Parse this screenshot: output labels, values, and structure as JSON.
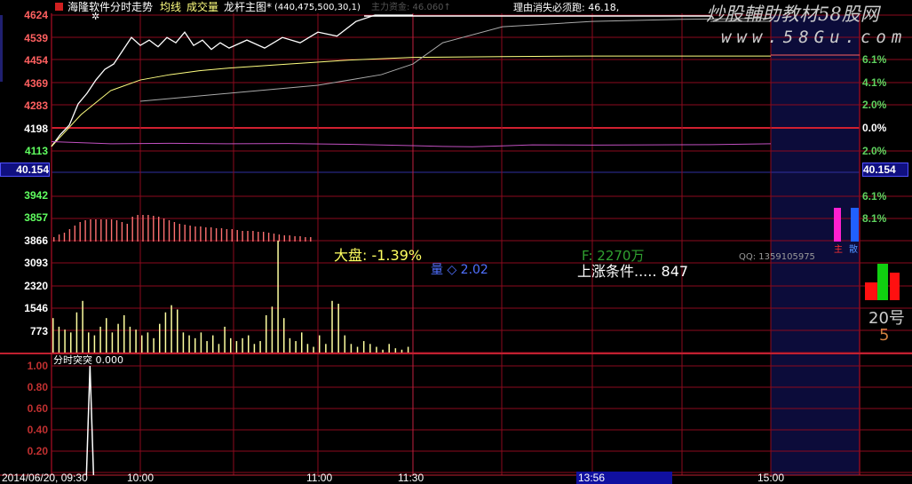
{
  "header": {
    "title": "海隆软件分时走势",
    "ma_label": "均线",
    "vol_label": "成交量",
    "main_label": "龙杆主图*",
    "params": "(440,475,500,30,1)",
    "main_force": "主力资金: 46.060↑",
    "reason": "理由消失必须跑: 46.18,"
  },
  "watermark": {
    "line1": "炒股輔助教材58股网",
    "line2": "www.58Gu.com"
  },
  "overlay": {
    "market": "大盘: -1.39%",
    "volume_ratio": "量 ◇ 2.02",
    "amount": "F: 2270万",
    "qq": "QQ: 1359105975",
    "rise_cond": "上涨条件..... 847"
  },
  "left_axis": {
    "price": [
      "4624",
      "4539",
      "4454",
      "4369",
      "4283",
      "4198",
      "4113"
    ],
    "highlight": "40.154",
    "lower": [
      "3942",
      "3857",
      "3866"
    ],
    "volume": [
      "3093",
      "2320",
      "1546",
      "773"
    ],
    "indicator": [
      "1.00",
      "0.80",
      "0.60",
      "0.40",
      "0.20"
    ]
  },
  "right_axis": {
    "pct": [
      "6.1%",
      "4.1%",
      "2.0%",
      "0.0%",
      "2.0%"
    ],
    "highlight": "40.154",
    "lower": [
      "6.1%",
      "8.1%"
    ],
    "labels": [
      "主",
      "散"
    ],
    "day": "20号",
    "num": "5"
  },
  "indicator": {
    "label": "分时突突 0.000"
  },
  "time_axis": {
    "date": "2014/06/20, 09:30",
    "ticks": [
      "10:00",
      "11:00",
      "11:30",
      "15:00"
    ],
    "cursor": "13:56"
  },
  "colors": {
    "grid": "#8b0a1e",
    "price": "#ffffff",
    "avg": "#ffff80",
    "trend": "#aaaaaa",
    "purple": "#c050c0",
    "volume": "#ffffa0",
    "upper_bars": "#ff7070",
    "shade": "#0c0c3a"
  },
  "chart_data": {
    "type": "line",
    "title": "海隆软件分时走势",
    "x_unit": "minutes since 09:30 (trading time)",
    "xlim": [
      0,
      240
    ],
    "ylim": [
      4113,
      4624
    ],
    "series": [
      {
        "name": "price",
        "x": [
          0,
          3,
          6,
          9,
          12,
          15,
          18,
          21,
          24,
          27,
          30,
          33,
          36,
          39,
          42,
          45,
          48,
          51,
          54,
          57,
          60,
          66,
          72,
          78,
          84,
          90,
          96,
          102,
          108,
          114,
          120
        ],
        "values": [
          4130,
          4175,
          4210,
          4290,
          4330,
          4380,
          4420,
          4440,
          4490,
          4540,
          4510,
          4530,
          4505,
          4540,
          4520,
          4560,
          4510,
          4530,
          4495,
          4520,
          4500,
          4530,
          4500,
          4540,
          4520,
          4560,
          4545,
          4600,
          4624,
          4624,
          4624
        ]
      },
      {
        "name": "avg",
        "x": [
          0,
          10,
          20,
          30,
          40,
          50,
          60,
          80,
          100,
          120,
          150,
          180,
          210,
          240
        ],
        "values": [
          4130,
          4250,
          4340,
          4380,
          4400,
          4415,
          4425,
          4440,
          4455,
          4465,
          4468,
          4470,
          4470,
          4470
        ]
      },
      {
        "name": "trend",
        "x": [
          30,
          60,
          90,
          110,
          120,
          130,
          150,
          180,
          210,
          240
        ],
        "values": [
          4300,
          4330,
          4360,
          4400,
          4440,
          4520,
          4580,
          4600,
          4608,
          4612
        ]
      },
      {
        "name": "purple",
        "x": [
          0,
          20,
          40,
          60,
          80,
          100,
          120,
          130,
          140,
          150,
          160,
          180,
          200,
          220,
          240
        ],
        "values": [
          4148,
          4140,
          4142,
          4140,
          4141,
          4138,
          4133,
          4130,
          4129,
          4132,
          4136,
          4135,
          4136,
          4137,
          4140
        ]
      }
    ],
    "volume": {
      "ylim": [
        0,
        3866
      ],
      "x_step_min": 2,
      "values": [
        1200,
        900,
        800,
        700,
        1400,
        1800,
        700,
        600,
        900,
        1200,
        700,
        1000,
        1300,
        900,
        800,
        600,
        700,
        500,
        1000,
        1400,
        1650,
        1500,
        700,
        600,
        500,
        700,
        400,
        600,
        300,
        900,
        500,
        400,
        500,
        600,
        300,
        400,
        1300,
        1600,
        3900,
        1200,
        500,
        400,
        700,
        300,
        200,
        600,
        300,
        1800,
        1700,
        600,
        300,
        200,
        400,
        300,
        200,
        100,
        300,
        150,
        100,
        200
      ]
    },
    "upper_bars": [
      5,
      8,
      10,
      14,
      18,
      22,
      24,
      25,
      25,
      25,
      25,
      25,
      24,
      22,
      20,
      28,
      30,
      30,
      30,
      29,
      28,
      26,
      24,
      22,
      20,
      19,
      18,
      17,
      17,
      16,
      16,
      15,
      15,
      14,
      14,
      13,
      12,
      12,
      12,
      11,
      11,
      10,
      9,
      8,
      7,
      7,
      6,
      6,
      5,
      5
    ],
    "indicator": {
      "ylim": [
        0,
        1
      ],
      "spike_minute": 13,
      "value": 1.0
    }
  }
}
